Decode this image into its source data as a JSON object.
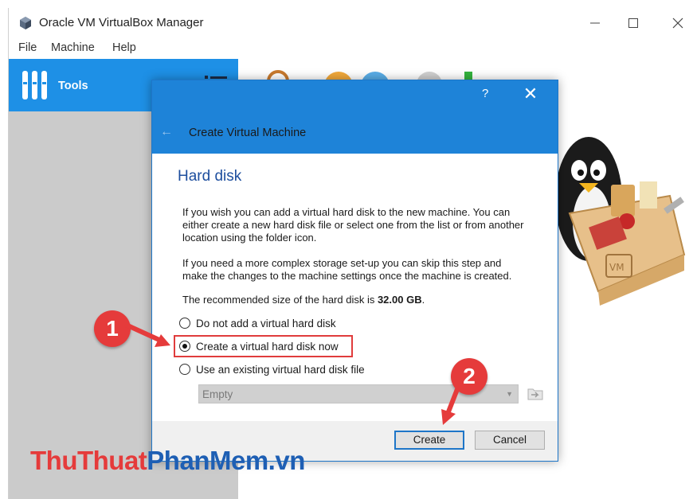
{
  "window": {
    "title": "Oracle VM VirtualBox Manager"
  },
  "menu": {
    "items": [
      "File",
      "Machine",
      "Help"
    ]
  },
  "sidebar": {
    "tools_label": "Tools"
  },
  "dialog": {
    "help_label": "?",
    "close_label": "✕",
    "back_label": "←",
    "title": "Create Virtual Machine",
    "section_title": "Hard disk",
    "paragraphs": [
      "If you wish you can add a virtual hard disk to the new machine. You can either create a new hard disk file or select one from the list or from another location using the folder icon.",
      "If you need a more complex storage set-up you can skip this step and make the changes to the machine settings once the machine is created."
    ],
    "recommended_prefix": "The recommended size of the hard disk is ",
    "recommended_size": "32.00 GB",
    "recommended_suffix": ".",
    "options": [
      {
        "label": "Do not add a virtual hard disk",
        "checked": false
      },
      {
        "label": "Create a virtual hard disk now",
        "checked": true
      },
      {
        "label": "Use an existing virtual hard disk file",
        "checked": false
      }
    ],
    "disk_select": {
      "value": "Empty"
    },
    "buttons": {
      "create": "Create",
      "cancel": "Cancel"
    }
  },
  "annotations": {
    "step1": "1",
    "step2": "2"
  },
  "watermark": {
    "part1": "ThuThuat",
    "part2": "PhanMem",
    "part3": ".vn"
  },
  "colors": {
    "accent": "#1e83d8",
    "highlight": "#e03c3c",
    "badge": "#e53b3b"
  }
}
